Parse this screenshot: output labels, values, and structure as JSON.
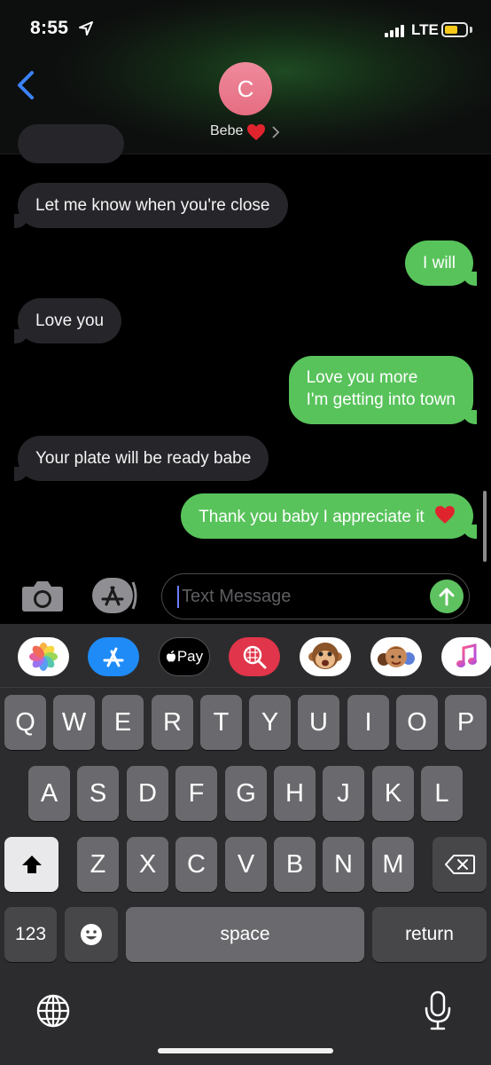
{
  "status_bar": {
    "time": "8:55",
    "network": "LTE"
  },
  "contact": {
    "initial": "C",
    "name": "Bebe"
  },
  "messages": [
    {
      "direction": "incoming",
      "text": "Let me know when you're close"
    },
    {
      "direction": "outgoing",
      "text": "I will"
    },
    {
      "direction": "incoming",
      "text": "Love you"
    },
    {
      "direction": "outgoing",
      "line1": "Love you more",
      "line2": "I'm getting into town"
    },
    {
      "direction": "incoming",
      "text": "Your plate will be ready babe"
    },
    {
      "direction": "outgoing",
      "text": "Thank you baby I appreciate it"
    }
  ],
  "composer": {
    "placeholder": "Text Message"
  },
  "app_strip": [
    {
      "icon": "photos-icon"
    },
    {
      "icon": "app-store-icon"
    },
    {
      "icon": "apple-pay-icon",
      "label": "Pay"
    },
    {
      "icon": "image-search-icon"
    },
    {
      "icon": "animoji-monkey-icon"
    },
    {
      "icon": "memoji-stickers-icon"
    },
    {
      "icon": "music-icon"
    }
  ],
  "keyboard": {
    "row1": [
      "Q",
      "W",
      "E",
      "R",
      "T",
      "Y",
      "U",
      "I",
      "O",
      "P"
    ],
    "row2": [
      "A",
      "S",
      "D",
      "F",
      "G",
      "H",
      "J",
      "K",
      "L"
    ],
    "row3": [
      "Z",
      "X",
      "C",
      "V",
      "B",
      "N",
      "M"
    ],
    "numbers_label": "123",
    "space_label": "space",
    "return_label": "return"
  },
  "colors": {
    "outgoing_bubble": "#58c35b",
    "incoming_bubble": "#26252a",
    "avatar": "#e97a8e",
    "battery": "#f4c91b",
    "back_chevron": "#3b82f6"
  }
}
